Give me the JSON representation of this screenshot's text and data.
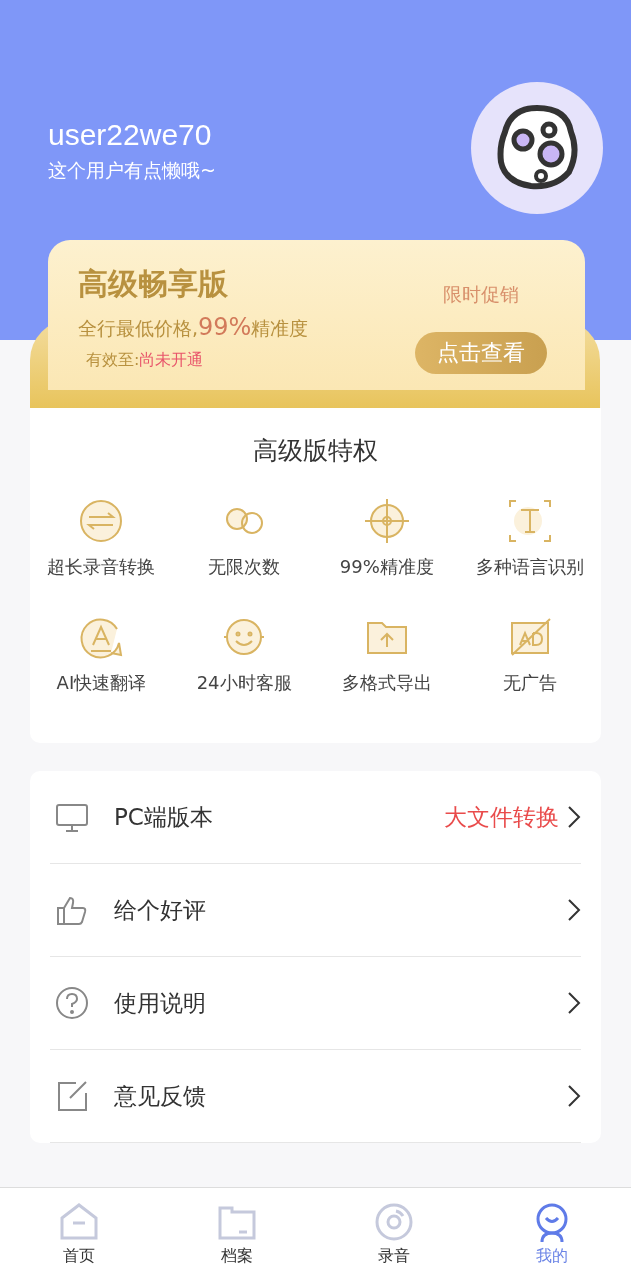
{
  "profile": {
    "username": "user22we70",
    "bio": "这个用户有点懒哦~"
  },
  "vip_card": {
    "title": "高级畅享版",
    "subtitle": "全行最低价格,**99%**精准度",
    "validity_label": "有效至:",
    "validity_value": "尚未开通",
    "promo": "限时促销",
    "button": "点击查看"
  },
  "privileges": {
    "title": "高级版特权",
    "items": [
      {
        "kind": "convert",
        "label": "超长录音转换"
      },
      {
        "kind": "infinite",
        "label": "无限次数"
      },
      {
        "kind": "target",
        "label": "99%精准度"
      },
      {
        "kind": "text",
        "label": "多种语言识别"
      },
      {
        "kind": "translate",
        "label": "AI快速翻译"
      },
      {
        "kind": "service",
        "label": "24小时客服"
      },
      {
        "kind": "export",
        "label": "多格式导出"
      },
      {
        "kind": "noad",
        "label": "无广告"
      }
    ]
  },
  "menu": [
    {
      "kind": "pc",
      "label": "PC端版本",
      "note": "大文件转换"
    },
    {
      "kind": "like",
      "label": "给个好评"
    },
    {
      "kind": "help",
      "label": "使用说明"
    },
    {
      "kind": "feedback",
      "label": "意见反馈"
    }
  ],
  "tab_bar": [
    {
      "kind": "home",
      "label": "首页",
      "selected": false
    },
    {
      "kind": "files",
      "label": "档案",
      "selected": false
    },
    {
      "kind": "record",
      "label": "录音",
      "selected": false
    },
    {
      "kind": "me",
      "label": "我的",
      "selected": true
    }
  ]
}
